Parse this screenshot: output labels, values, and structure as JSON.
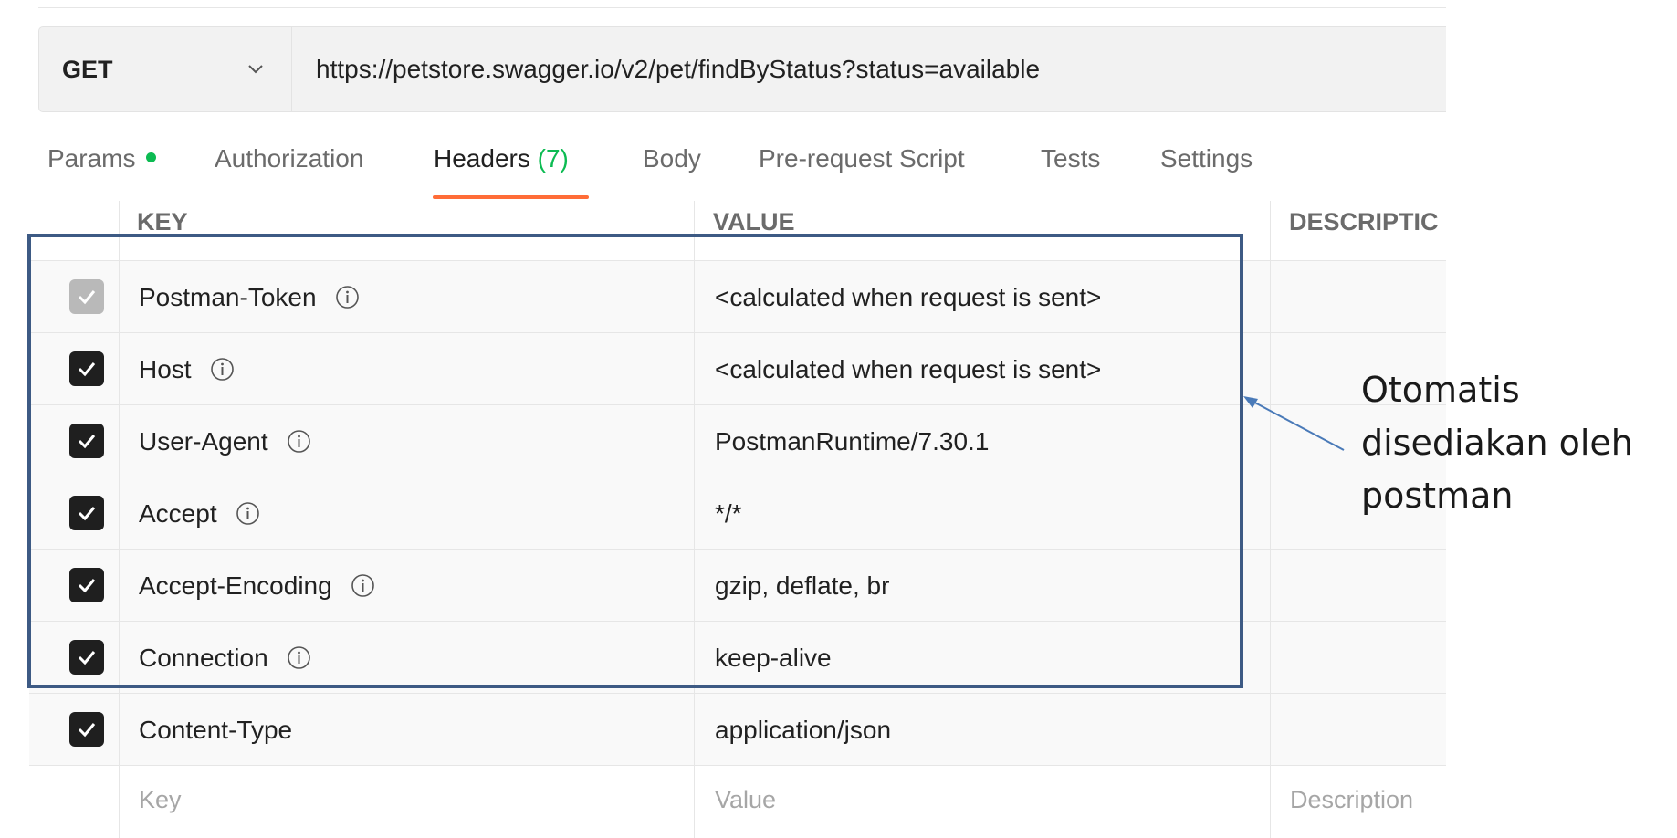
{
  "request": {
    "method": "GET",
    "url": "https://petstore.swagger.io/v2/pet/findByStatus?status=available"
  },
  "tabs": [
    {
      "label": "Params"
    },
    {
      "label": "Authorization"
    },
    {
      "label": "Headers",
      "count": "(7)",
      "active": true
    },
    {
      "label": "Body"
    },
    {
      "label": "Pre-request Script"
    },
    {
      "label": "Tests"
    },
    {
      "label": "Settings"
    }
  ],
  "table": {
    "columns": {
      "key": "KEY",
      "value": "VALUE",
      "description": "DESCRIPTIC"
    },
    "rows": [
      {
        "checked": true,
        "disabled": true,
        "key": "Postman-Token",
        "info": true,
        "value": "<calculated when request is sent>"
      },
      {
        "checked": true,
        "key": "Host",
        "info": true,
        "value": "<calculated when request is sent>"
      },
      {
        "checked": true,
        "key": "User-Agent",
        "info": true,
        "value": "PostmanRuntime/7.30.1"
      },
      {
        "checked": true,
        "key": "Accept",
        "info": true,
        "value": "*/*"
      },
      {
        "checked": true,
        "key": "Accept-Encoding",
        "info": true,
        "value": "gzip, deflate, br"
      },
      {
        "checked": true,
        "key": "Connection",
        "info": true,
        "value": "keep-alive"
      },
      {
        "checked": true,
        "key": "Content-Type",
        "info": false,
        "value": "application/json"
      }
    ],
    "placeholder": {
      "key": "Key",
      "value": "Value",
      "description": "Description"
    }
  },
  "annotation": {
    "lines": [
      "Otomatis",
      "disediakan oleh",
      "postman"
    ]
  },
  "colors": {
    "accent": "#ff6c37",
    "success": "#0cbb52",
    "highlight_border": "#3d5a84",
    "arrow": "#4a7ab8"
  }
}
